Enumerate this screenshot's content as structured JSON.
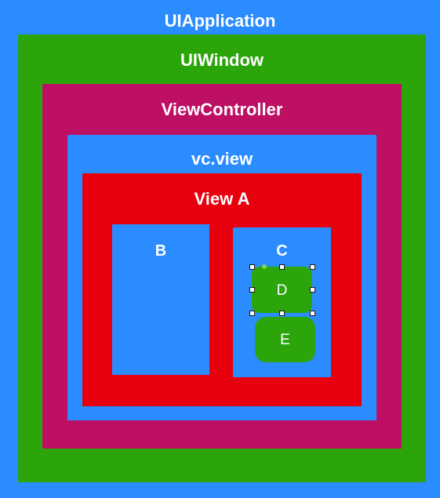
{
  "diagram": {
    "uiapplication": {
      "label": "UIApplication",
      "color": "#2a8cff"
    },
    "uiwindow": {
      "label": "UIWindow",
      "color": "#2ba50a"
    },
    "viewcontroller": {
      "label": "ViewController",
      "color": "#bd0f63"
    },
    "vcview": {
      "label": "vc.view",
      "color": "#2a8cff"
    },
    "viewa": {
      "label": "View A",
      "color": "#e8000f"
    },
    "viewb": {
      "label": "B",
      "color": "#2a8cff"
    },
    "viewc": {
      "label": "C",
      "color": "#2a8cff"
    },
    "viewd": {
      "label": "D",
      "color": "#2ba50a",
      "selected": true
    },
    "viewe": {
      "label": "E",
      "color": "#2ba50a"
    }
  }
}
